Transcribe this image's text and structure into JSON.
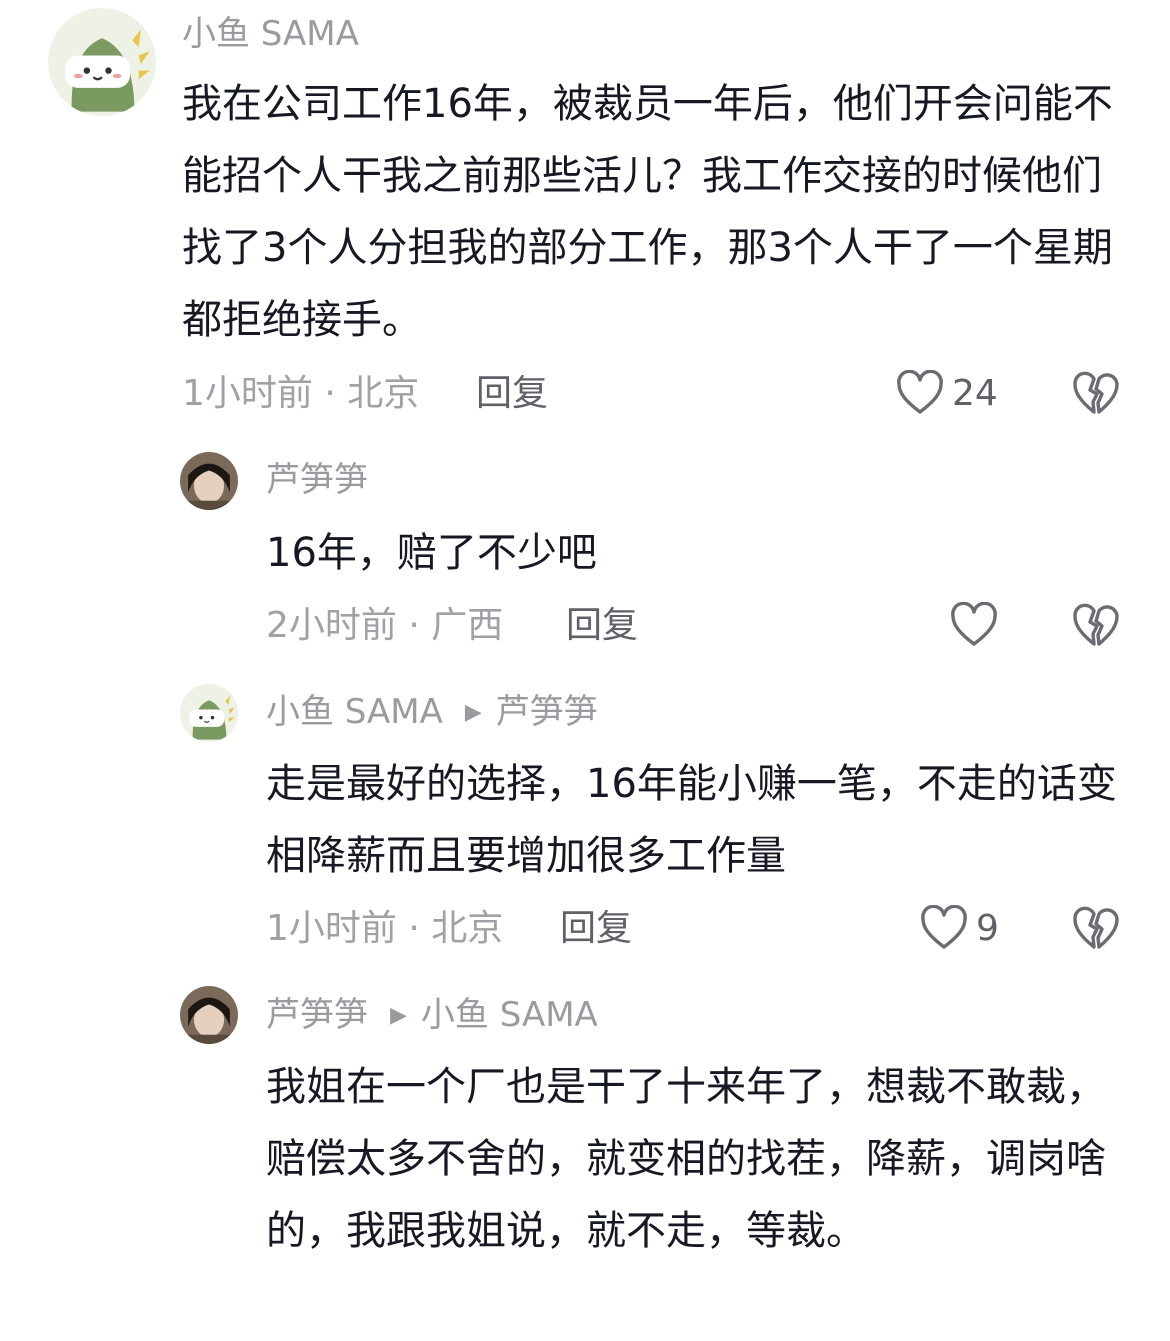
{
  "comments": [
    {
      "user": "小鱼 SAMA",
      "text": "我在公司工作16年，被裁员一年后，他们开会问能不能招个人干我之前那些活儿？我工作交接的时候他们找了3个人分担我的部分工作，那3个人干了一个星期都拒绝接手。",
      "meta": "1小时前 · 北京",
      "reply": "回复",
      "likes": "24"
    },
    {
      "user": "芦笋笋",
      "text": "16年，赔了不少吧",
      "meta": "2小时前 · 广西",
      "reply": "回复",
      "likes": ""
    },
    {
      "user": "小鱼 SAMA",
      "reply_to": "芦笋笋",
      "text": "走是最好的选择，16年能小赚一笔，不走的话变相降薪而且要增加很多工作量",
      "meta": "1小时前 · 北京",
      "reply": "回复",
      "likes": "9"
    },
    {
      "user": "芦笋笋",
      "reply_to": "小鱼 SAMA",
      "text": "我姐在一个厂也是干了十来年了，想裁不敢裁，赔偿太多不舍的，就变相的找茬，降薪，调岗啥的，我跟我姐说，就不走，等裁。"
    }
  ],
  "icons": {
    "like": "heart-outline-icon",
    "dislike": "broken-heart-icon",
    "reply_arrow": "triangle-right-icon"
  },
  "colors": {
    "text": "#161823",
    "username": "#9a9ba1",
    "meta": "#a0a1a7",
    "action": "#5f6068"
  }
}
